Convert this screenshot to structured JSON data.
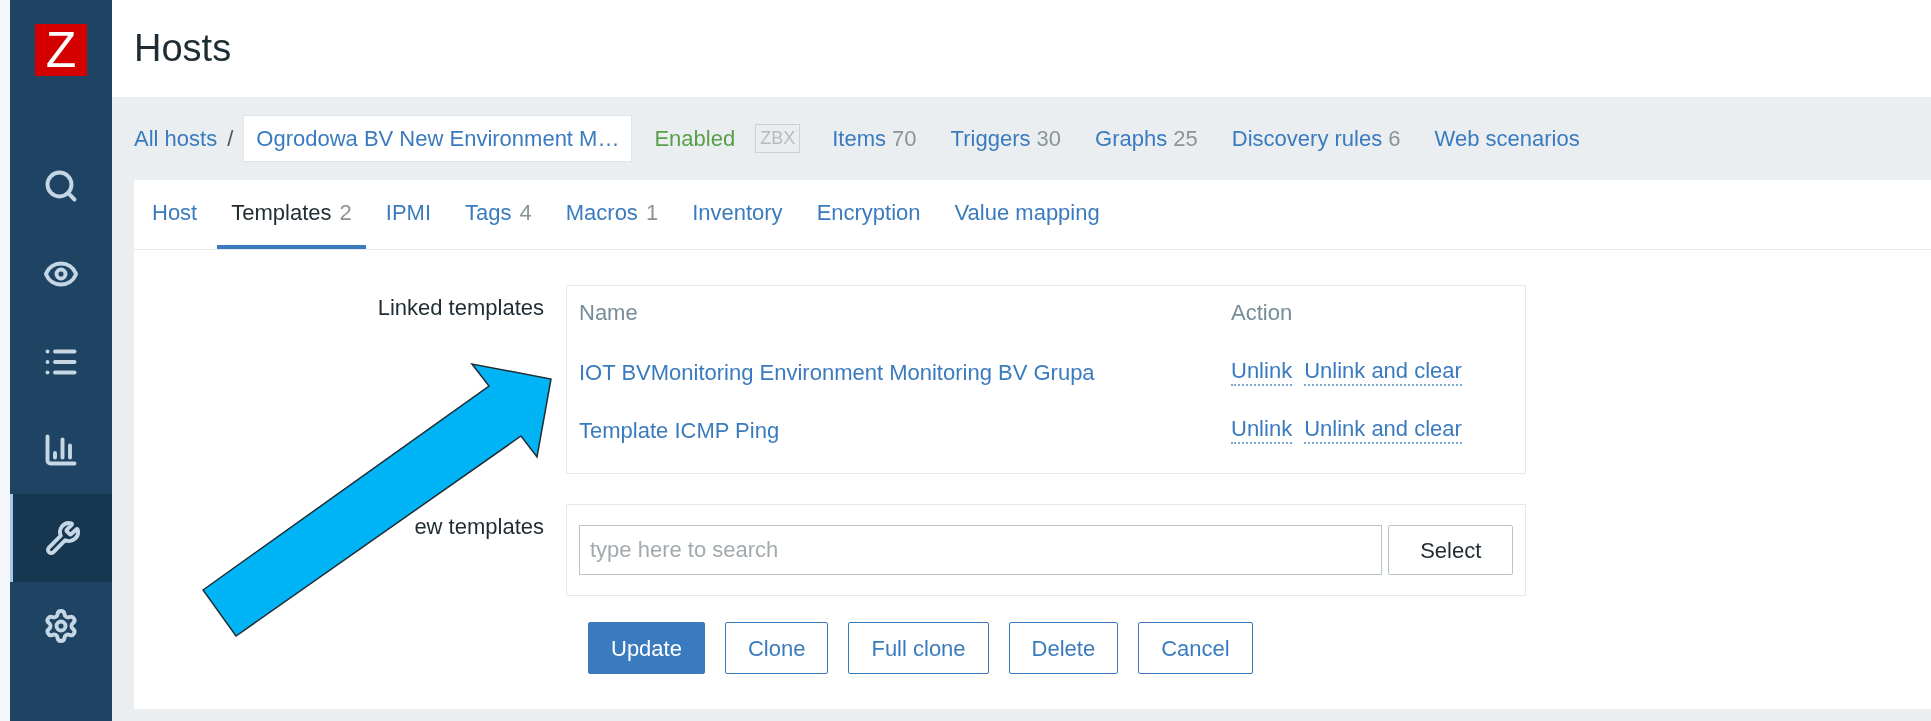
{
  "page_title": "Hosts",
  "breadcrumb": {
    "all_hosts": "All hosts",
    "separator": "/",
    "host_name": "Ogrodowa BV New Environment M…",
    "status": "Enabled",
    "status_enabled": true,
    "agent_badge": "ZBX",
    "agent_available": false
  },
  "host_links": [
    {
      "label": "Items",
      "count": "70"
    },
    {
      "label": "Triggers",
      "count": "30"
    },
    {
      "label": "Graphs",
      "count": "25"
    },
    {
      "label": "Discovery rules",
      "count": "6"
    },
    {
      "label": "Web scenarios"
    }
  ],
  "sidebar": {
    "logo": "Z",
    "items": [
      {
        "selected": false
      },
      {
        "selected": false
      },
      {
        "selected": false
      },
      {
        "selected": false
      },
      {
        "selected": true
      },
      {
        "selected": false
      }
    ]
  },
  "tabs": [
    {
      "label": "Host",
      "selected": false
    },
    {
      "label": "Templates",
      "count": "2",
      "selected": true
    },
    {
      "label": "IPMI",
      "selected": false
    },
    {
      "label": "Tags",
      "count": "4",
      "selected": false
    },
    {
      "label": "Macros",
      "count": "1",
      "selected": false
    },
    {
      "label": "Inventory",
      "selected": false
    },
    {
      "label": "Encryption",
      "selected": false
    },
    {
      "label": "Value mapping",
      "selected": false
    }
  ],
  "linked_templates": {
    "label": "Linked templates",
    "columns": [
      "Name",
      "Action"
    ],
    "rows": [
      {
        "name": "IOT BVMonitoring Environment Monitoring BV Grupa",
        "actions": [
          "Unlink",
          "Unlink and clear"
        ]
      },
      {
        "name": "Template ICMP Ping",
        "actions": [
          "Unlink",
          "Unlink and clear"
        ]
      }
    ]
  },
  "link_new": {
    "label": "ew templates",
    "placeholder": "type here to search",
    "button": "Select"
  },
  "buttons": [
    {
      "label": "Update",
      "primary": true
    },
    {
      "label": "Clone",
      "primary": false
    },
    {
      "label": "Full clone",
      "primary": false
    },
    {
      "label": "Delete",
      "primary": false
    },
    {
      "label": "Cancel",
      "primary": false
    }
  ]
}
